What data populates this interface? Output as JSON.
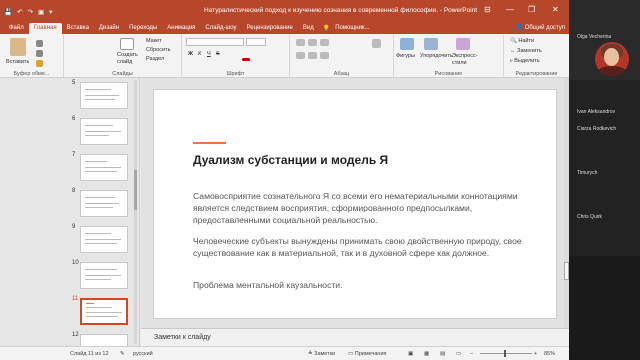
{
  "window": {
    "title": "Натуралистический подход к изучению сознания в современной философии. - PowerPoint",
    "min": "—",
    "restore": "❐",
    "close": "✕",
    "ribbon_toggle": "⊟"
  },
  "tabs": [
    "Файл",
    "Главная",
    "Вставка",
    "Дизайн",
    "Переходы",
    "Анимация",
    "Слайд-шоу",
    "Рецензирование",
    "Вид",
    "Помощник..."
  ],
  "tabs_extra": {
    "tell_icon": "lightbulb-icon",
    "share": "Общий доступ"
  },
  "ribbon": {
    "clipboard": {
      "paste": "Вставить",
      "label": "Буфер обме..."
    },
    "slides": {
      "new": "Создать слайд",
      "layout": "Макет",
      "reset": "Сбросить",
      "section": "Раздел",
      "label": "Слайды"
    },
    "font": {
      "label": "Шрифт",
      "bold": "Ж",
      "italic": "К",
      "underline": "Ч",
      "strike": "S"
    },
    "paragraph": {
      "label": "Абзац"
    },
    "drawing": {
      "shapes": "Фигуры",
      "arrange": "Упорядочить",
      "quick_styles": "Экспресс-стили",
      "label": "Рисование"
    },
    "editing": {
      "find": "Найти",
      "replace": "Заменить",
      "select": "Выделить",
      "label": "Редактирование"
    }
  },
  "thumbnails": [
    {
      "num": "5"
    },
    {
      "num": "6"
    },
    {
      "num": "7"
    },
    {
      "num": "8"
    },
    {
      "num": "9"
    },
    {
      "num": "10"
    },
    {
      "num": "11"
    },
    {
      "num": "12"
    }
  ],
  "slide": {
    "title": "Дуализм субстанции и модель Я",
    "paragraphs": [
      "Самовосприятие сознательного Я со всеми его нематериальными коннотациями является следствием восприятия, сформированного предпосылками, предоставленными социальной реальностью.",
      "Человеческие субъекты вынуждены принимать свою двойственную природу, свое существование как в материальной, так и в духовной сфере как должное.",
      "Проблема ментальной каузальности."
    ],
    "accent_color": "#e97744"
  },
  "notes": {
    "placeholder": "Заметки к слайду"
  },
  "status": {
    "slide": "Слайд 11 из 12",
    "lang": "русский",
    "notes": "Заметки",
    "comments": "Примечания",
    "zoom": "85%"
  },
  "participants": [
    {
      "name": "Olga Vecherina"
    },
    {
      "name": "Ivan Aleksandrov"
    },
    {
      "name": "Ciarza Rodkevich"
    },
    {
      "name": "Timurych"
    },
    {
      "name": "Chris Quirk"
    }
  ],
  "colors": {
    "accent": "#b7472a",
    "selected_thumb": "#d24726"
  }
}
